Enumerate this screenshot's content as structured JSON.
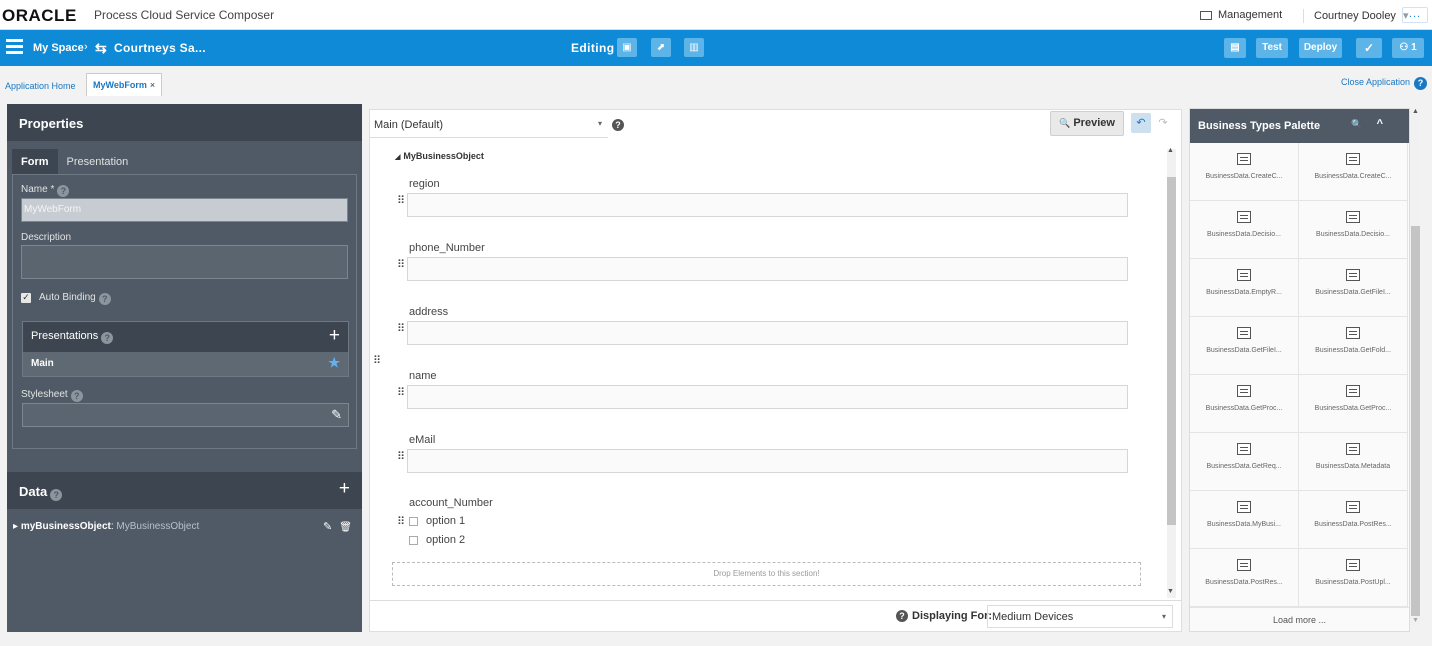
{
  "topbar": {
    "logo": "ORACLE",
    "app_name": "Process Cloud Service Composer",
    "management": "Management",
    "user": "Courtney Dooley",
    "user_caret": "▾",
    "more": "..."
  },
  "header": {
    "space": "My Space",
    "separator": "›",
    "app_icon": "⇆",
    "app": "Courtneys Sa...",
    "mode": "Editing",
    "save_icon": "▣",
    "publish_icon": "⬈",
    "delete_icon": "▥",
    "snapshot_icon": "▤",
    "test_label": "Test",
    "deploy_label": "Deploy",
    "validate_icon": "✓",
    "users_label": "⚇ 1"
  },
  "tabs": {
    "home": "Application Home",
    "active": "MyWebForm",
    "close_x": "×",
    "close_app": "Close Application",
    "help": "?"
  },
  "properties": {
    "title": "Properties",
    "tab_form": "Form",
    "tab_presentation": "Presentation",
    "name_label": "Name",
    "required_star": "*",
    "name_value": "MyWebForm",
    "description_label": "Description",
    "auto_binding_label": "Auto Binding",
    "auto_binding_check": "✓",
    "presentations_label": "Presentations",
    "plus": "+",
    "presentation_main": "Main",
    "star": "★",
    "stylesheet_label": "Stylesheet",
    "pencil": "✎",
    "help": "?"
  },
  "data_panel": {
    "title": "Data",
    "plus": "+",
    "expander": "▸",
    "item_name": "myBusinessObject",
    "item_type": "MyBusinessObject",
    "edit_icon": "✎",
    "delete_icon": "🗑"
  },
  "canvas": {
    "presentation_select": "Main (Default)",
    "caret": "▾",
    "help": "?",
    "preview_label": "Preview",
    "preview_icon": "🔍",
    "undo_icon": "↶",
    "redo_icon": "↷",
    "section_expander": "◢",
    "section_title": "MyBusinessObject",
    "grip": "⠿",
    "fields": [
      "region",
      "phone_Number",
      "address",
      "name",
      "eMail"
    ],
    "checkbox_label": "account_Number",
    "options": [
      "option 1",
      "option 2"
    ],
    "drop_zone": "Drop Elements to this section!",
    "scroll_up": "▲",
    "scroll_down": "▼",
    "displaying_for_label": "Displaying For:",
    "device_select": "Medium Devices"
  },
  "palette": {
    "title": "Business Types Palette",
    "search_icon": "🔍",
    "collapse_icon": "^",
    "items": [
      "BusinessData.CreateC...",
      "BusinessData.CreateC...",
      "BusinessData.Decisio...",
      "BusinessData.Decisio...",
      "BusinessData.EmptyR...",
      "BusinessData.GetFileI...",
      "BusinessData.GetFileI...",
      "BusinessData.GetFold...",
      "BusinessData.GetProc...",
      "BusinessData.GetProc...",
      "BusinessData.GetReq...",
      "BusinessData.Metadata",
      "BusinessData.MyBusi...",
      "BusinessData.PostRes...",
      "BusinessData.PostRes...",
      "BusinessData.PostUpl..."
    ],
    "load_more": "Load more ...",
    "scroll_up": "▲",
    "scroll_down": "▼"
  }
}
